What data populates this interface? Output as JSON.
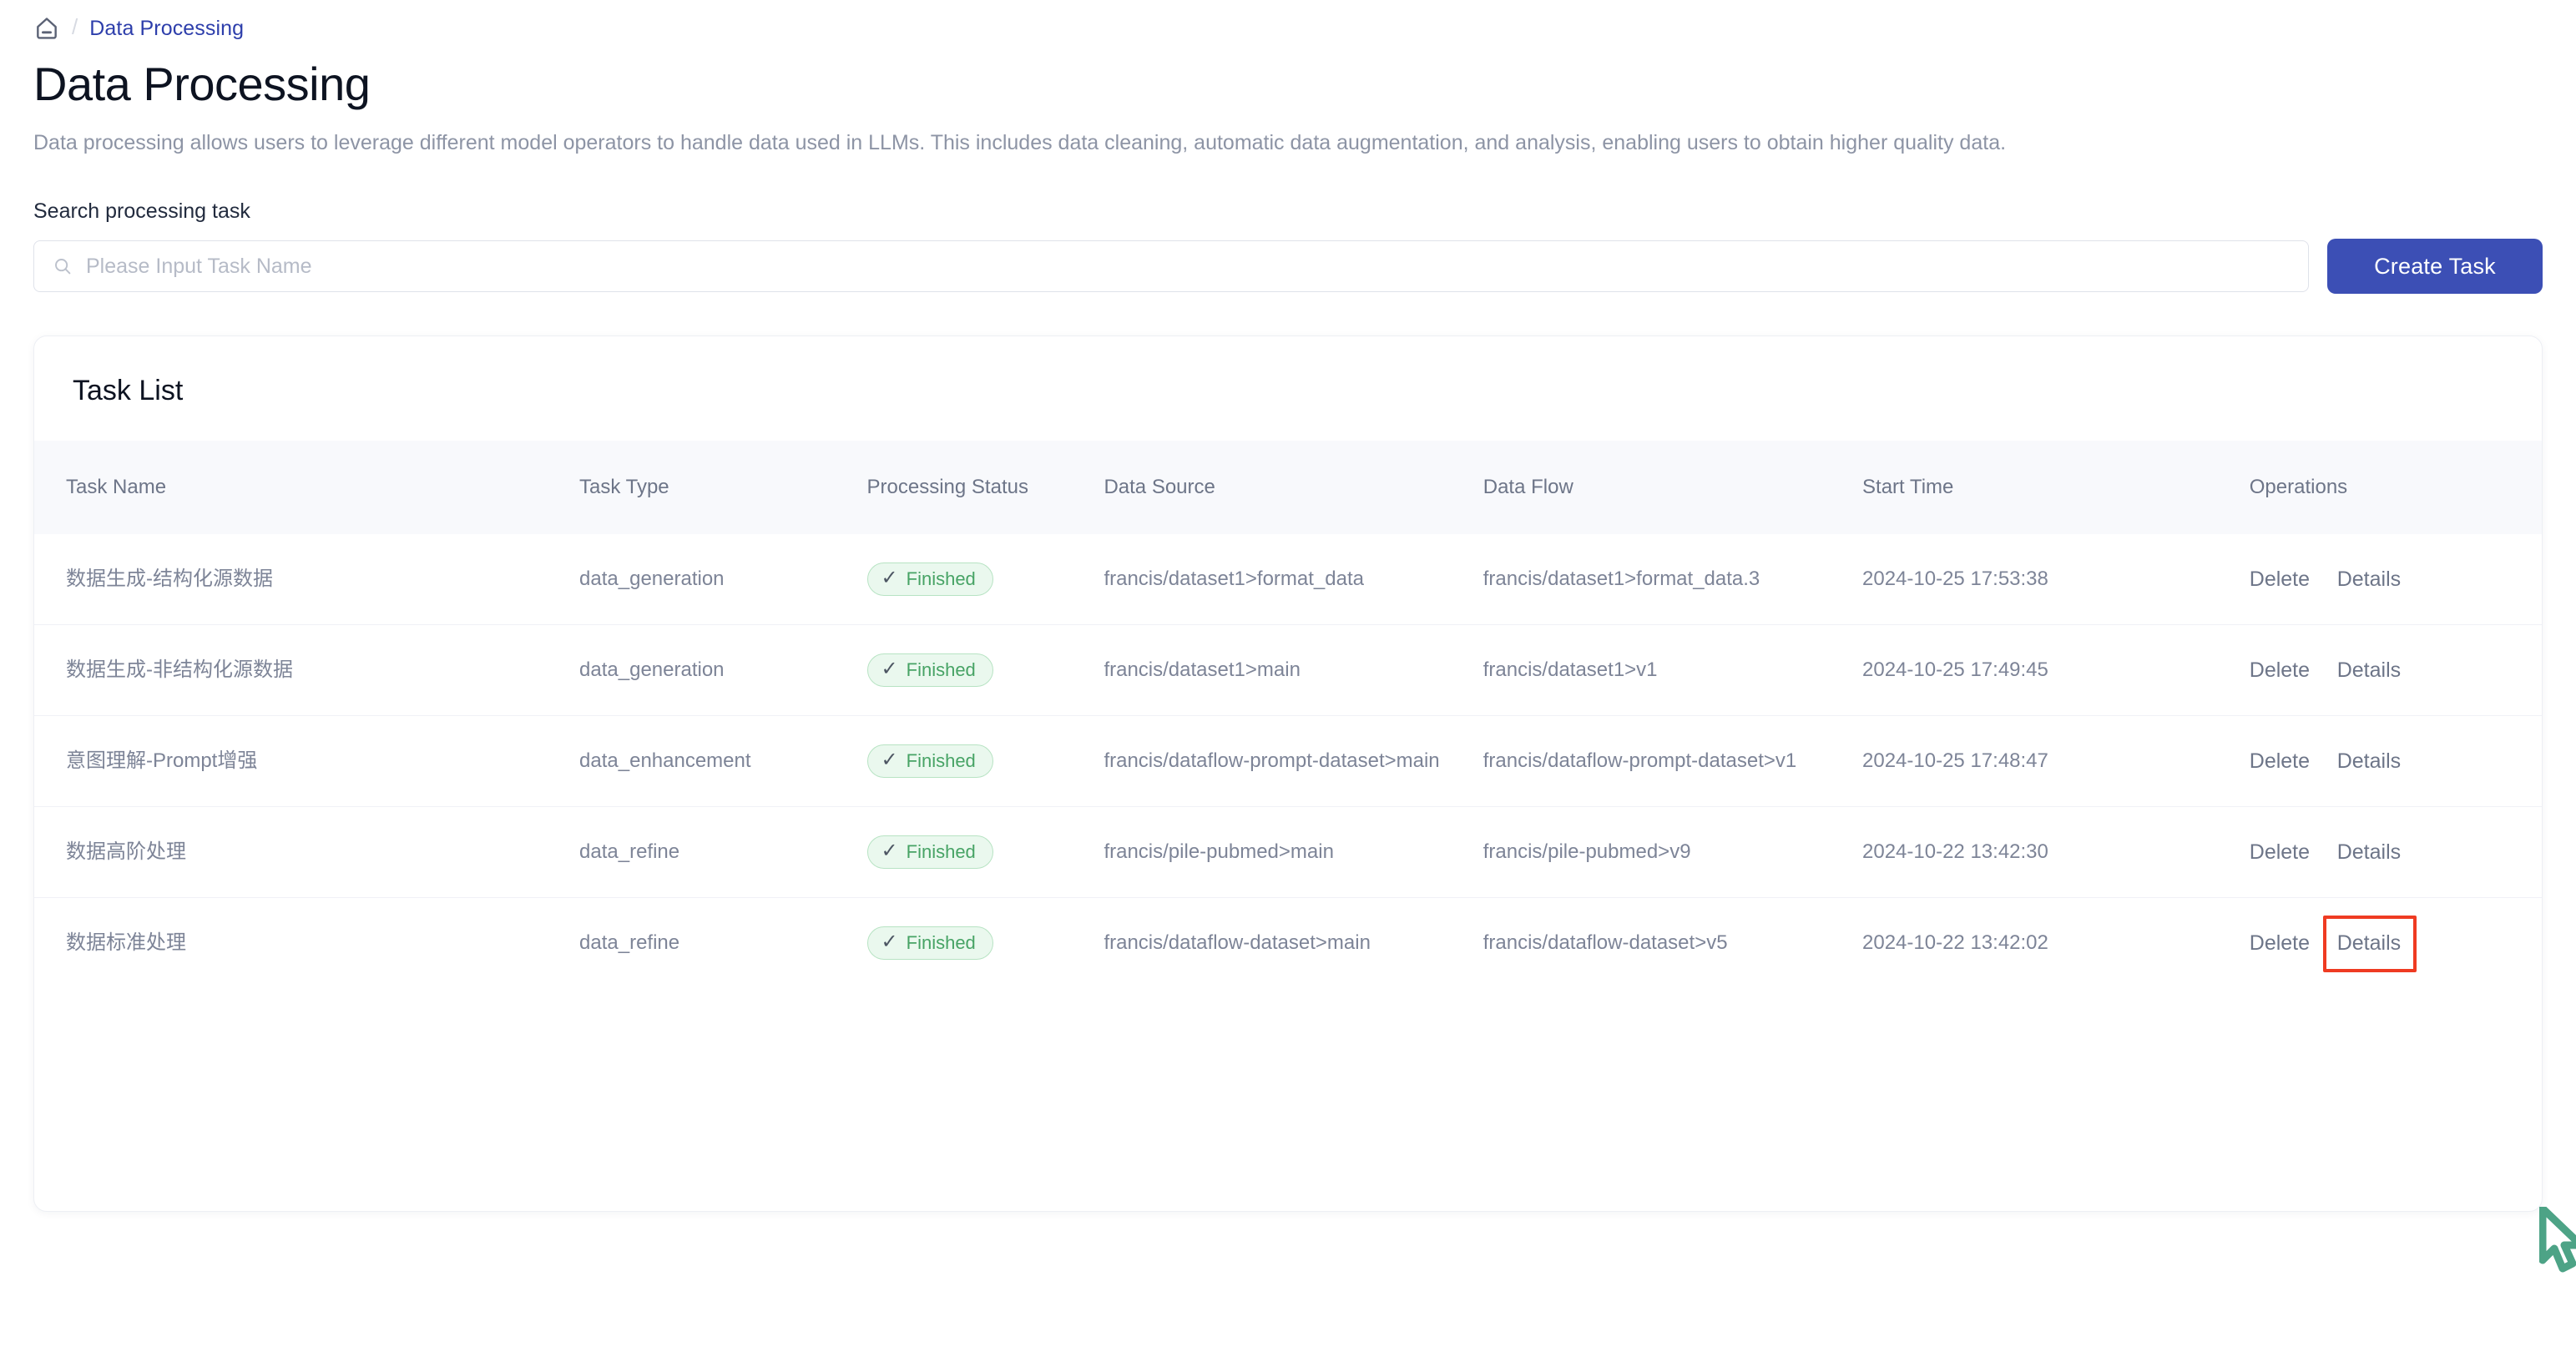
{
  "breadcrumb": {
    "home_icon": "home-icon",
    "separator": "/",
    "current": "Data Processing"
  },
  "header": {
    "title": "Data Processing",
    "description": "Data processing allows users to leverage different model operators to handle data used in LLMs. This includes data cleaning, automatic data augmentation, and analysis, enabling users to obtain higher quality data."
  },
  "search": {
    "label": "Search processing task",
    "placeholder": "Please Input Task Name",
    "value": "",
    "icon": "search-icon",
    "create_button": "Create Task"
  },
  "card": {
    "title": "Task List"
  },
  "table": {
    "columns": [
      "Task Name",
      "Task Type",
      "Processing Status",
      "Data Source",
      "Data Flow",
      "Start Time",
      "Operations"
    ],
    "rows": [
      {
        "name": "数据生成-结构化源数据",
        "type": "data_generation",
        "status": "Finished",
        "source": "francis/dataset1>format_data",
        "flow": "francis/dataset1>format_data.3",
        "start_time": "2024-10-25 17:53:38",
        "op_delete": "Delete",
        "op_details": "Details"
      },
      {
        "name": "数据生成-非结构化源数据",
        "type": "data_generation",
        "status": "Finished",
        "source": "francis/dataset1>main",
        "flow": "francis/dataset1>v1",
        "start_time": "2024-10-25 17:49:45",
        "op_delete": "Delete",
        "op_details": "Details"
      },
      {
        "name": "意图理解-Prompt增强",
        "type": "data_enhancement",
        "status": "Finished",
        "source": "francis/dataflow-prompt-dataset>main",
        "flow": "francis/dataflow-prompt-dataset>v1",
        "start_time": "2024-10-25 17:48:47",
        "op_delete": "Delete",
        "op_details": "Details"
      },
      {
        "name": "数据高阶处理",
        "type": "data_refine",
        "status": "Finished",
        "source": "francis/pile-pubmed>main",
        "flow": "francis/pile-pubmed>v9",
        "start_time": "2024-10-22 13:42:30",
        "op_delete": "Delete",
        "op_details": "Details"
      },
      {
        "name": "数据标准处理",
        "type": "data_refine",
        "status": "Finished",
        "source": "francis/dataflow-dataset>main",
        "flow": "francis/dataflow-dataset>v5",
        "start_time": "2024-10-22 13:42:02",
        "op_delete": "Delete",
        "op_details": "Details"
      }
    ]
  },
  "annotation": {
    "highlight_target": "Details",
    "highlight_color": "#ef3b22",
    "cursor_color": "#4da386"
  },
  "colors": {
    "accent": "#3c4fb5",
    "link": "#2d3eab",
    "status_green_text": "#47a365",
    "status_green_bg": "#eaf8ee",
    "muted_text": "#8d94a5"
  }
}
